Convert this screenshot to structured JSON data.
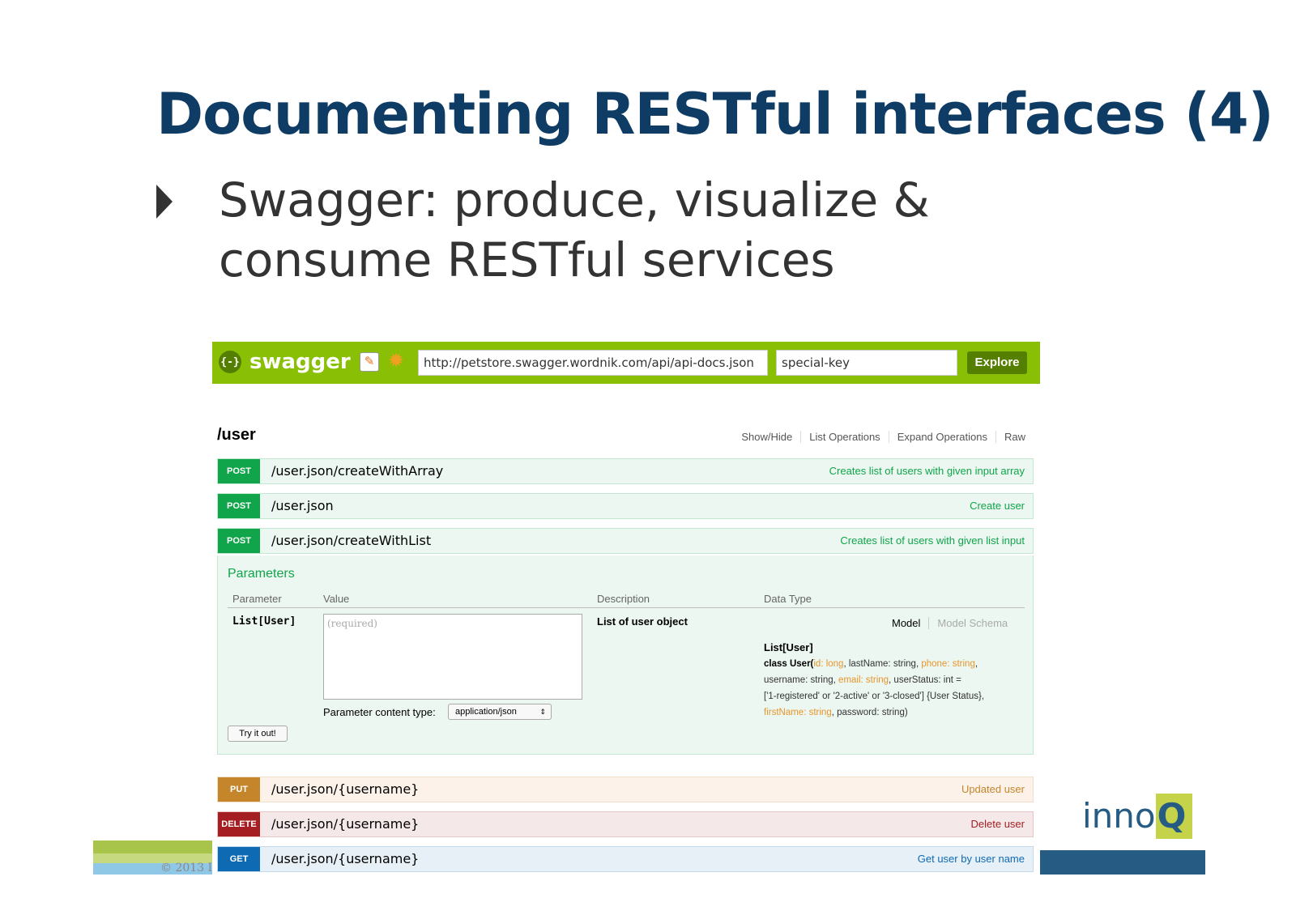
{
  "slide": {
    "title": "Documenting RESTful interfaces (4)",
    "bullet": "Swagger: produce, visualize & consume RESTful services",
    "copyright": "© 2013 I",
    "brand_logo": "innoQ"
  },
  "swagger": {
    "logo_text": "swagger",
    "logo_icon_glyph": "{-}",
    "url": "http://petstore.swagger.wordnik.com/api/api-docs.json",
    "api_key": "special-key",
    "explore_label": "Explore",
    "colors": {
      "header": "#89bf04",
      "post": "#10a54a",
      "put": "#c5862b",
      "delete": "#a41e22",
      "get": "#0f6ab4"
    }
  },
  "resource": {
    "title": "/user",
    "links": [
      "Show/Hide",
      "List Operations",
      "Expand Operations",
      "Raw"
    ]
  },
  "operations": [
    {
      "method": "POST",
      "path": "/user.json/createWithArray",
      "summary": "Creates list of users with given input array"
    },
    {
      "method": "POST",
      "path": "/user.json",
      "summary": "Create user"
    },
    {
      "method": "POST",
      "path": "/user.json/createWithList",
      "summary": "Creates list of users with given list input"
    },
    {
      "method": "PUT",
      "path": "/user.json/{username}",
      "summary": "Updated user"
    },
    {
      "method": "DELETE",
      "path": "/user.json/{username}",
      "summary": "Delete user"
    },
    {
      "method": "GET",
      "path": "/user.json/{username}",
      "summary": "Get user by user name"
    }
  ],
  "expanded": {
    "heading": "Parameters",
    "columns": [
      "Parameter",
      "Value",
      "Description",
      "Data Type"
    ],
    "param_name": "List[User]",
    "param_placeholder": "(required)",
    "param_description": "List of user object",
    "content_type_label": "Parameter content type:",
    "content_type_value": "application/json",
    "try_label": "Try it out!",
    "tab_model": "Model",
    "tab_schema": "Model Schema",
    "model_title": "List[User]",
    "model": {
      "class_prefix": "class User(",
      "f1": "id: long",
      "f2": ", lastName: string, ",
      "f3": "phone: string",
      "f4": ",",
      "f5": "username: string, ",
      "f6": "email: string",
      "f7": ", userStatus: int =",
      "f8": "['1-registered' or '2-active' or '3-closed'] {User Status},",
      "f9": "firstName: string",
      "f10": ", password: string)"
    }
  }
}
